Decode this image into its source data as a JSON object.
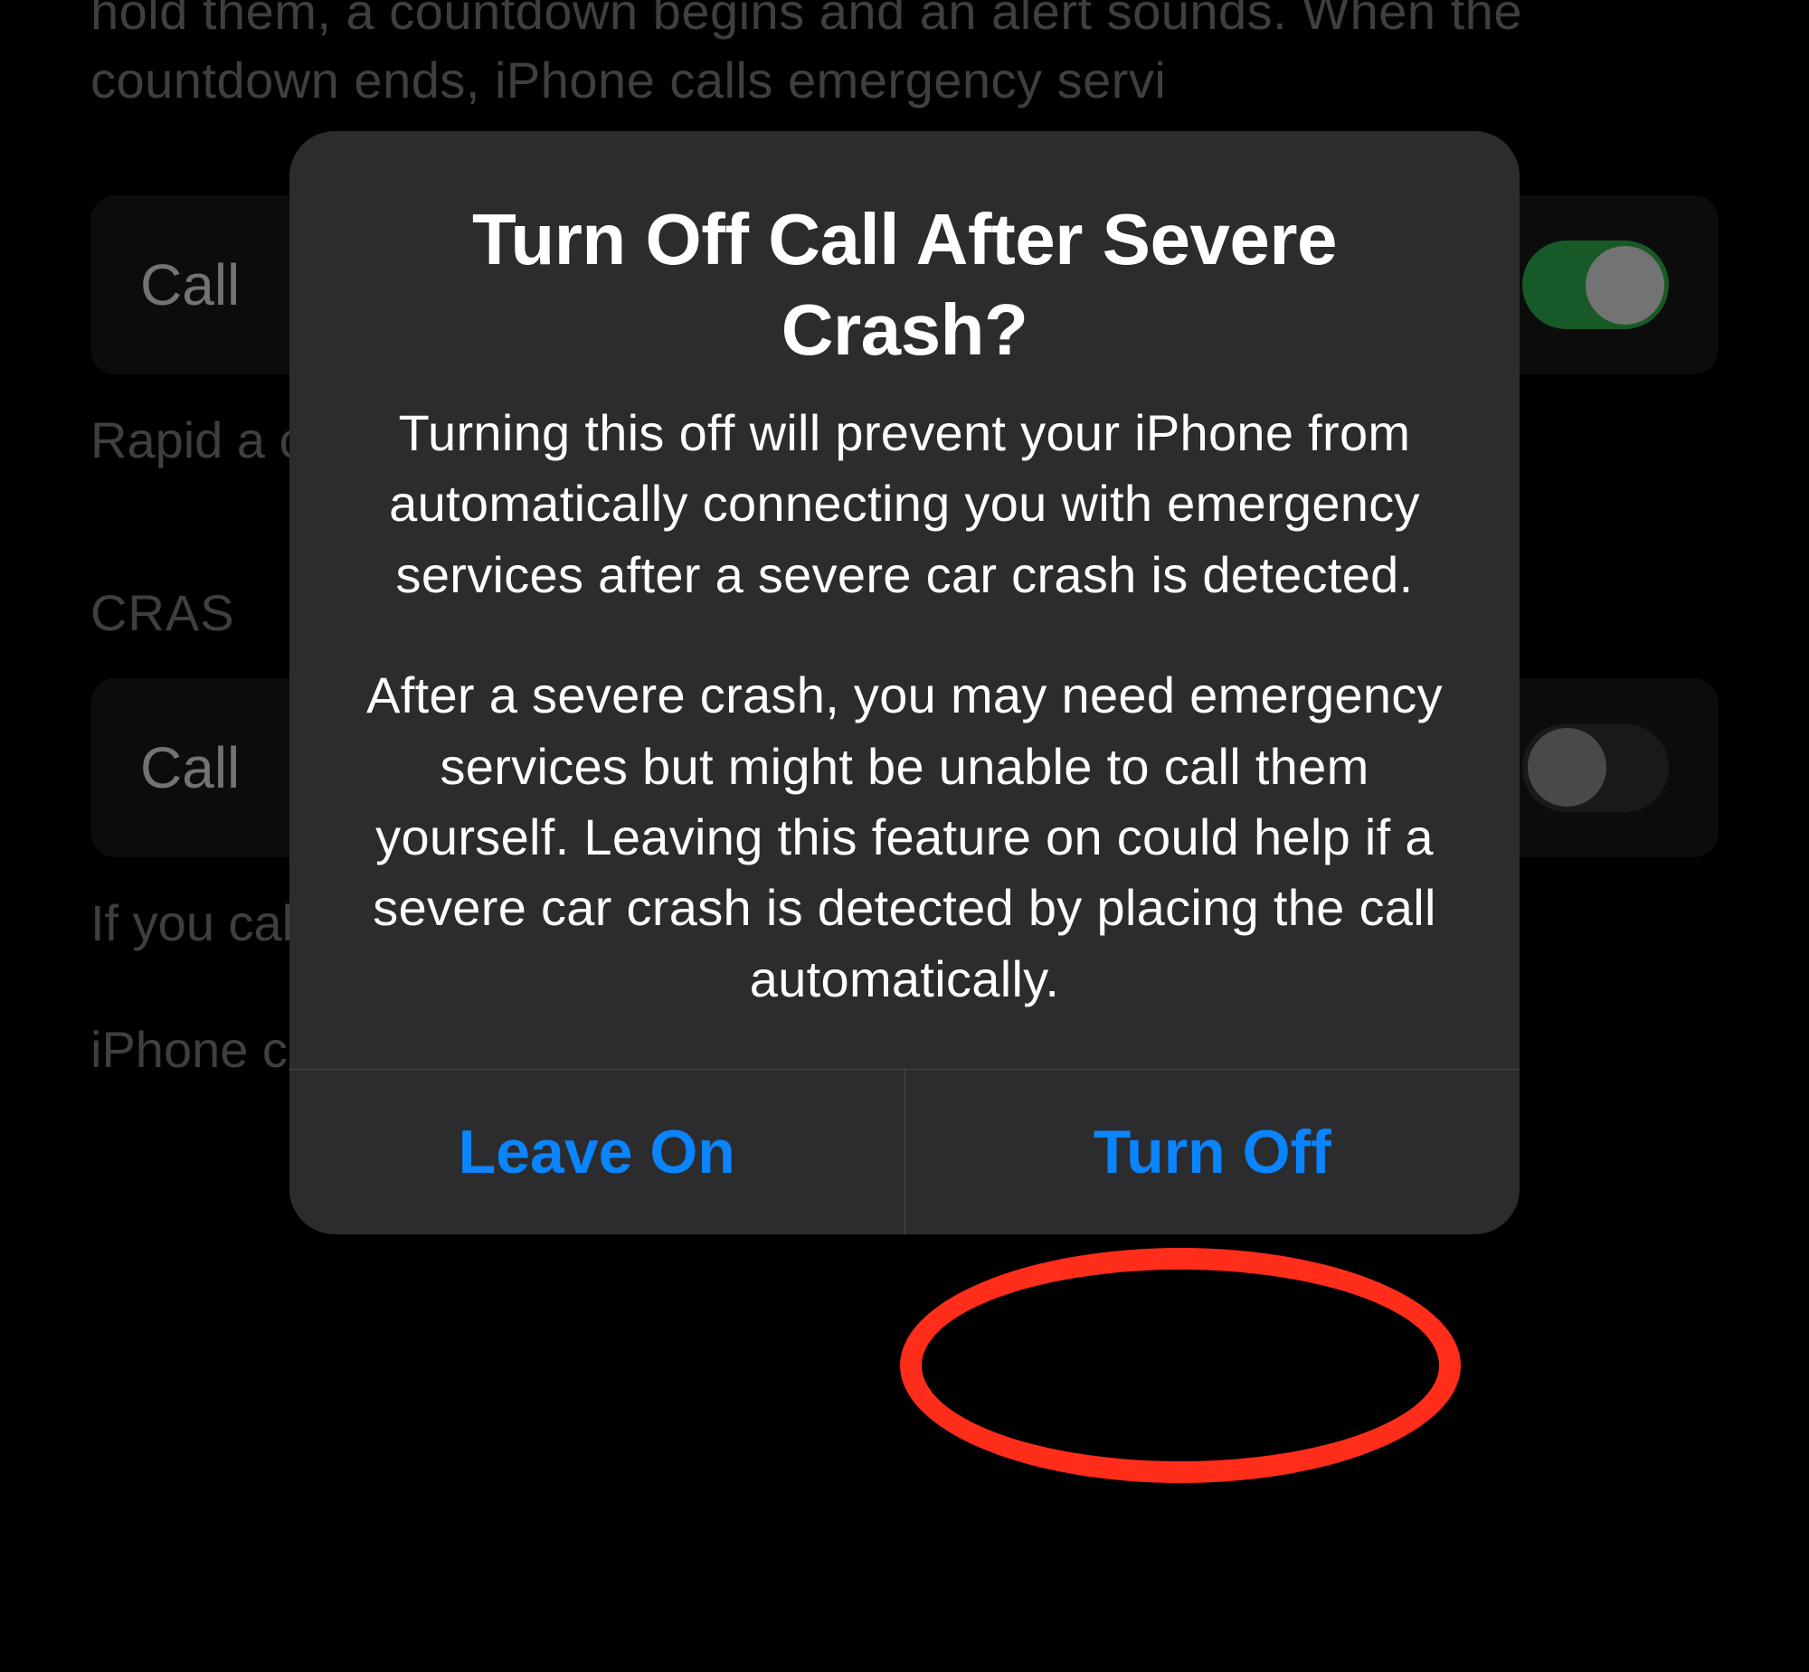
{
  "background": {
    "intro_text": "hold them, a countdown begins and an alert sounds. When the countdown ends, iPhone calls emergency servi",
    "setting1_label": "Call",
    "footer1": "Rapid                                                                                                          a countdown                                                                                                       own ends",
    "section_header": "CRAS",
    "setting2_label": "Call",
    "footer2": "If you                                                                                                             call emer                                                                                                          n and s",
    "footer3": "iPhone cannot detect all crashes."
  },
  "alert": {
    "title": "Turn Off Call After Severe Crash?",
    "message1": "Turning this off will prevent your iPhone from automatically connecting you with emergency services after a severe car crash is detected.",
    "message2": "After a severe crash, you may need emergency services but might be unable to call them yourself. Leaving this feature on could help if a severe car crash is detected by placing the call automatically.",
    "button_leave_on": "Leave On",
    "button_turn_off": "Turn Off"
  }
}
